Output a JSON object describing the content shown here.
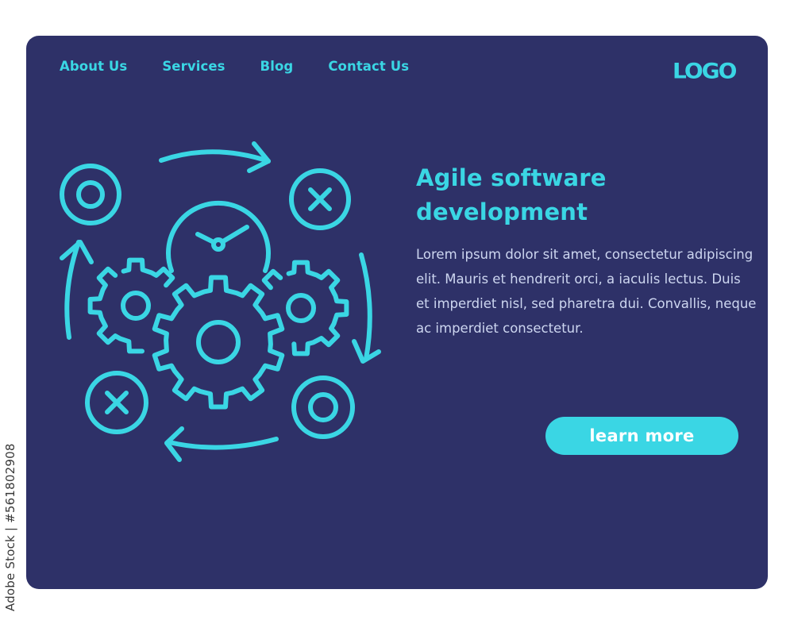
{
  "credit": "Adobe Stock | #561802908",
  "nav": {
    "items": [
      {
        "label": "About Us"
      },
      {
        "label": "Services"
      },
      {
        "label": "Blog"
      },
      {
        "label": "Contact Us"
      }
    ]
  },
  "logo": "LOGO",
  "hero": {
    "title": "Agile software development",
    "body": "Lorem ipsum dolor sit amet, consectetur adipiscing elit. Mauris et hendrerit orci, a iaculis lectus. Duis et imperdiet nisl, sed pharetra dui. Convallis, neque ac imperdiet consectetur.",
    "cta_label": "learn more"
  },
  "illustration": {
    "name": "agile-cycle-icon",
    "elements": [
      "cycle-arrows",
      "clock",
      "gears",
      "target-circles",
      "x-circles"
    ]
  },
  "colors": {
    "background": "#2e3168",
    "accent": "#3ad6e4",
    "body_text": "#cdd6f0"
  }
}
